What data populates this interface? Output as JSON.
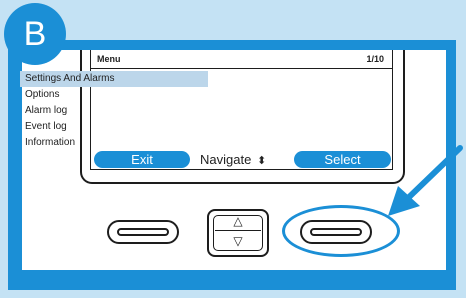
{
  "badge": {
    "letter": "B"
  },
  "screen": {
    "header": {
      "title": "Menu",
      "page": "1/10"
    },
    "menu_items": [
      {
        "label": "Settings And Alarms",
        "selected": true
      },
      {
        "label": "Options",
        "selected": false
      },
      {
        "label": "Alarm log",
        "selected": false
      },
      {
        "label": "Event log",
        "selected": false
      },
      {
        "label": "Information",
        "selected": false
      }
    ],
    "softkeys": {
      "exit": "Exit",
      "navigate": "Navigate",
      "navigate_icon": "⬍",
      "select": "Select"
    }
  },
  "hardware": {
    "nav_up": "△",
    "nav_down": "▽"
  },
  "colors": {
    "accent": "#1b8fd6",
    "background": "#c4e2f4",
    "selection": "#bcd6ea"
  }
}
